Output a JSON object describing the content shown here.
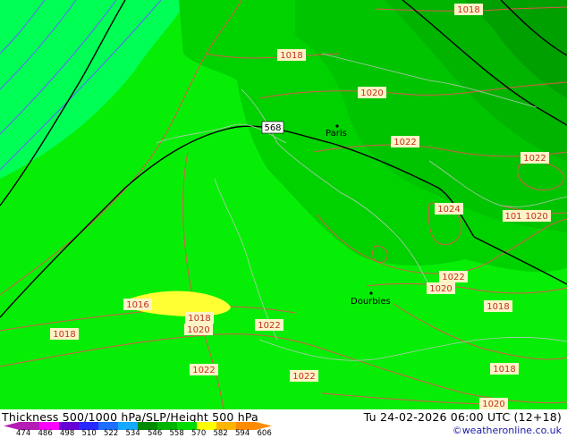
{
  "map": {
    "colors": {
      "bright_green": "#06ee06",
      "green_mid": "#00d200",
      "green_dark": "#00b400",
      "green_darkest": "#009600",
      "cyan_green": "#00ff55",
      "yellow_patch": "#ffff33",
      "isobar_color": "#d85a4a",
      "height_contour_color": "#000000",
      "thickness_color": "#6464ff"
    },
    "pressure_labels": [
      "1018",
      "1018",
      "1020",
      "1022",
      "1022",
      "1024",
      "101",
      "1020",
      "1022",
      "1020",
      "1018",
      "1016",
      "1018",
      "1020",
      "1018",
      "1022",
      "1022",
      "1022",
      "1018",
      "1020"
    ],
    "height_labels": [
      "568"
    ],
    "cities": [
      {
        "name": "Paris"
      },
      {
        "name": "Dourbies"
      }
    ]
  },
  "footer": {
    "title": "Thickness 500/1000 hPa/SLP/Height 500 hPa",
    "valid": "Tu 24-02-2026 06:00 UTC (12+18)",
    "credit": "©weatheronline.co.uk",
    "scale_ticks": [
      "474",
      "486",
      "498",
      "510",
      "522",
      "534",
      "546",
      "558",
      "570",
      "582",
      "594",
      "606"
    ],
    "scale_colors": [
      "#b41eb4",
      "#ff00ff",
      "#6a00d8",
      "#2828ff",
      "#1e6eff",
      "#14aaff",
      "#008c00",
      "#00b400",
      "#00dc00",
      "#ffff00",
      "#ffb400",
      "#ff8c00"
    ]
  }
}
